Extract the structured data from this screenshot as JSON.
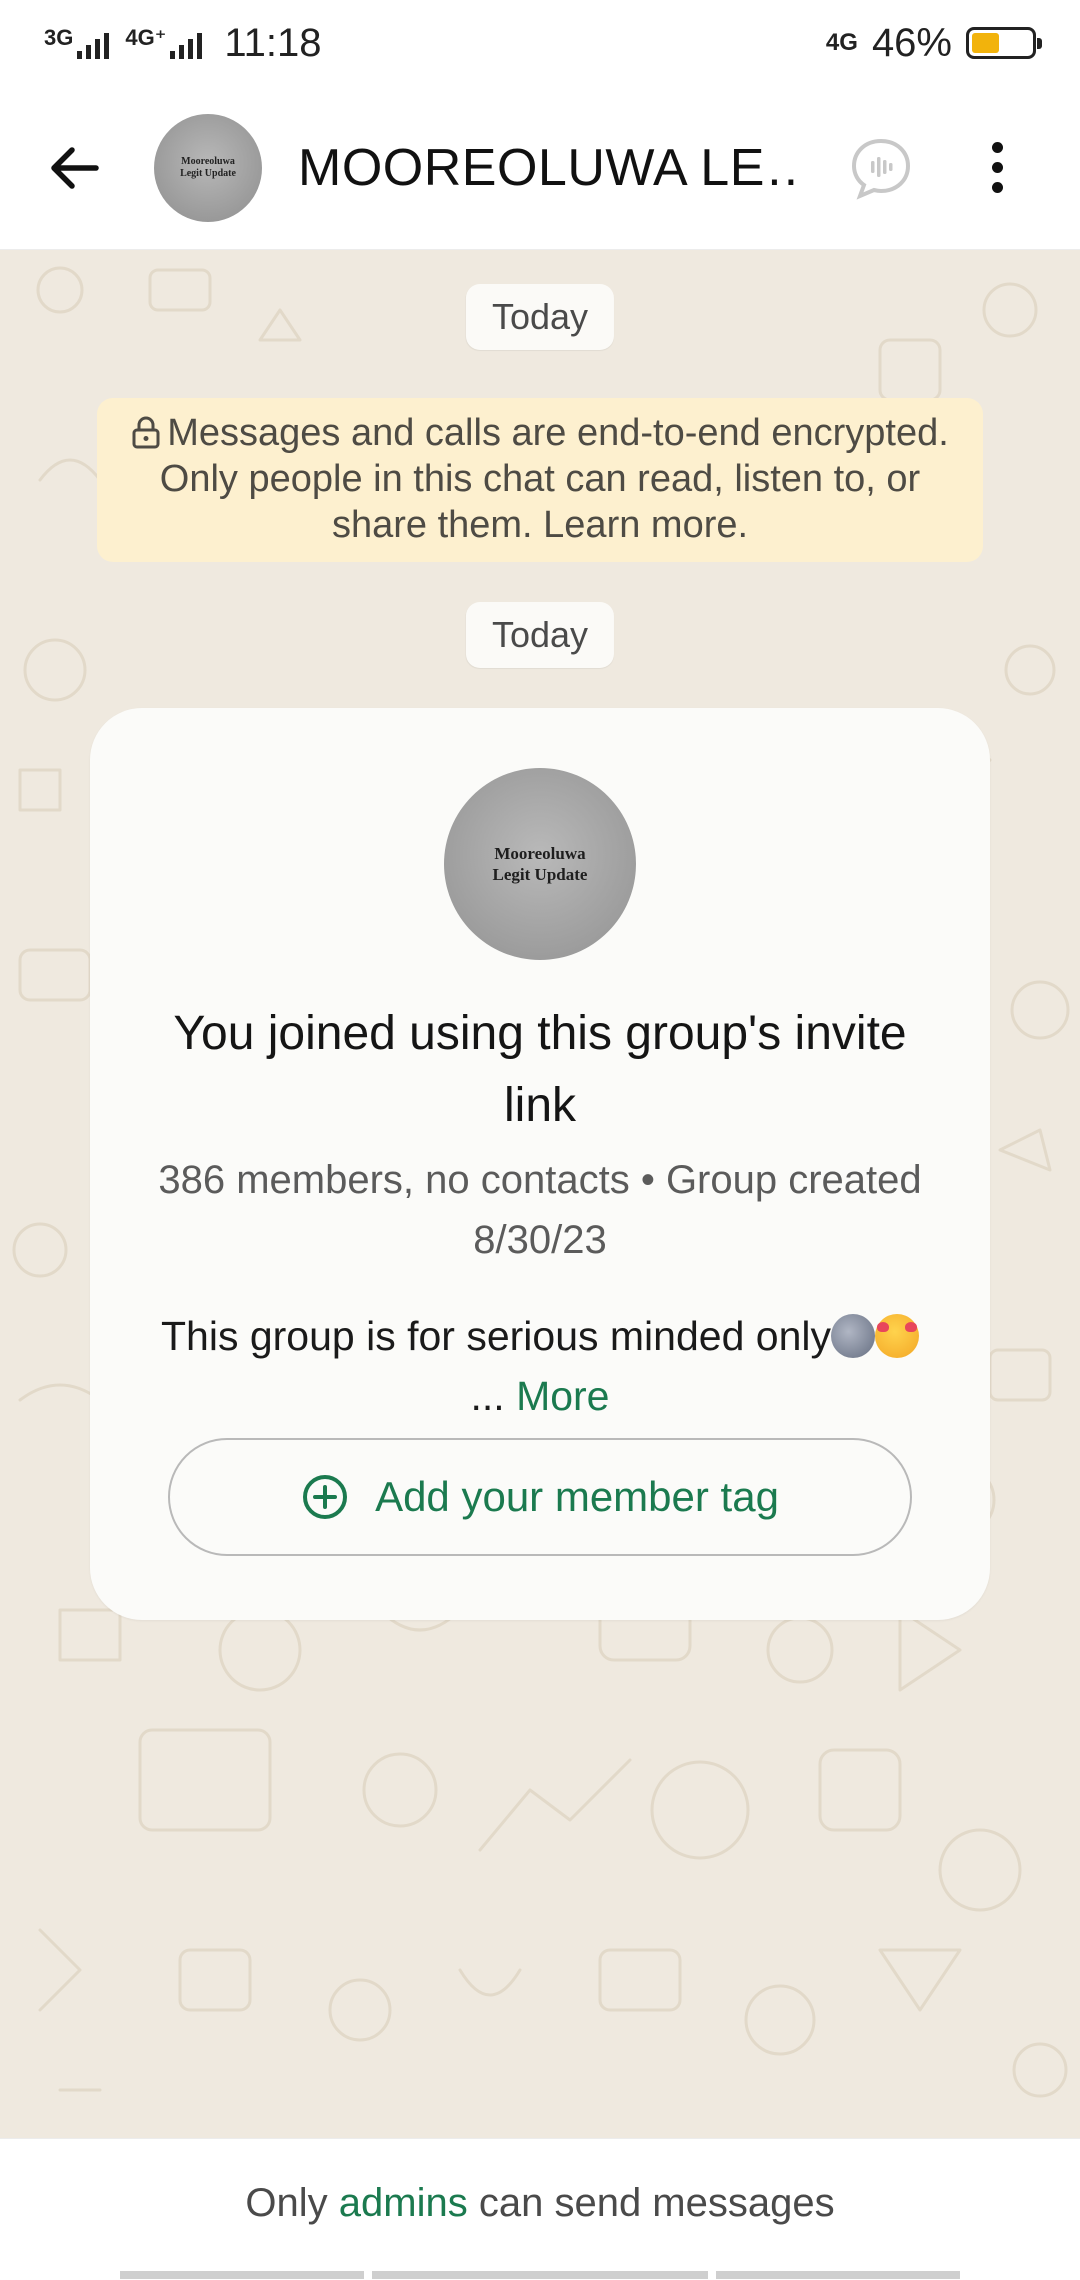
{
  "status_bar": {
    "net1": "3G",
    "net2": "4G⁺",
    "time": "11:18",
    "net_right": "4G",
    "battery_text": "46%",
    "battery_level": 0.46,
    "battery_color": "#f2b30c"
  },
  "header": {
    "title": "MOOREOLUWA LE…",
    "avatar_text": "Mooreoluwa Legit Update",
    "icons": [
      "back-arrow-icon",
      "voice-chat-icon",
      "more-vert-icon"
    ]
  },
  "chat": {
    "date_chip_1": "Today",
    "encryption_notice": "Messages and calls are end-to-end encrypted. Only people in this chat can read, listen to, or share them. Learn more.",
    "date_chip_2": "Today"
  },
  "group_card": {
    "avatar_text": "Mooreoluwa Legit Update",
    "title": "You joined using this group's invite link",
    "meta": "386 members, no contacts • Group created 8/30/23",
    "description": "This group is for serious minded only",
    "ellipsis": "...",
    "more_label": "More",
    "member_tag_button": "Add your member tag"
  },
  "footer": {
    "prefix": "Only",
    "admins_link": "admins",
    "suffix": "can send messages"
  },
  "colors": {
    "accent_green": "#1b7a4f",
    "chat_background": "#efe9df",
    "notice_background": "#fdf0cf"
  }
}
